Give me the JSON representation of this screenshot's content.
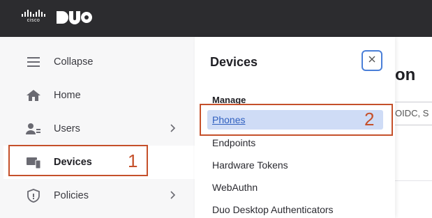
{
  "header": {
    "cisco_logo_text": "cisco",
    "duo_logo_text": "DUO"
  },
  "sidebar": {
    "items": [
      {
        "label": "Collapse",
        "icon": "hamburger-icon",
        "has_chevron": false
      },
      {
        "label": "Home",
        "icon": "home-icon",
        "has_chevron": false
      },
      {
        "label": "Users",
        "icon": "users-icon",
        "has_chevron": true
      },
      {
        "label": "Devices",
        "icon": "devices-icon",
        "has_chevron": false,
        "active": true
      },
      {
        "label": "Policies",
        "icon": "shield-icon",
        "has_chevron": true
      }
    ]
  },
  "flyout": {
    "title": "Devices",
    "close_icon": "close-icon",
    "section_label": "Manage",
    "items": [
      {
        "label": "Phones",
        "selected": true
      },
      {
        "label": "Endpoints"
      },
      {
        "label": "Hardware Tokens"
      },
      {
        "label": "WebAuthn"
      },
      {
        "label": "Duo Desktop Authenticators"
      }
    ]
  },
  "page": {
    "title_fragment": "on",
    "field_fragment": "OIDC, S"
  },
  "annotations": {
    "step1": "1",
    "step2": "2",
    "color": "#c5502a"
  }
}
